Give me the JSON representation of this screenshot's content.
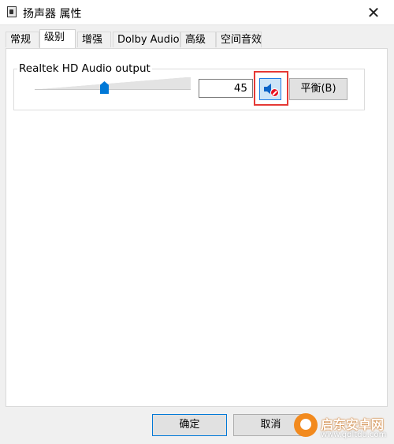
{
  "window": {
    "title": "扬声器 属性",
    "close_glyph": "✕"
  },
  "tabs": [
    {
      "label": "常规"
    },
    {
      "label": "级别"
    },
    {
      "label": "增强"
    },
    {
      "label": "Dolby Audio"
    },
    {
      "label": "高级"
    },
    {
      "label": "空间音效"
    }
  ],
  "active_tab": "级别",
  "level_group": {
    "label": "Realtek HD Audio output",
    "slider_value": 45,
    "value_text": "45",
    "mute_state": "muted",
    "balance_label": "平衡(B)"
  },
  "footer": {
    "ok_label": "确定",
    "cancel_label": "取消"
  },
  "watermark": {
    "line1": "启东安卓网",
    "line2": "www.qdltdu.com"
  },
  "colors": {
    "accent": "#0078d7",
    "mute_highlight_box": "#e53935",
    "mute_badge": "#e81123"
  }
}
